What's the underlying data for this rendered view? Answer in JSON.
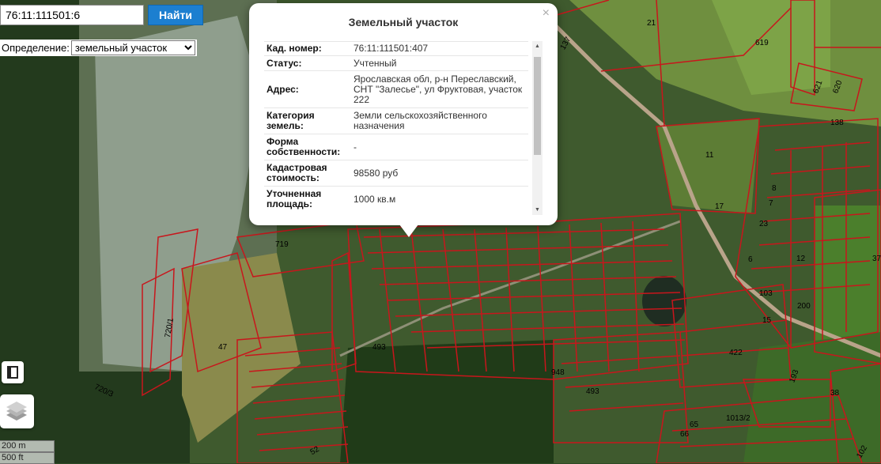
{
  "search": {
    "value": "76:11:111501:6",
    "button": "Найти"
  },
  "definition": {
    "label": "Определение:",
    "selected": "земельный участок"
  },
  "popup": {
    "title": "Земельный участок",
    "close": "×",
    "rows": [
      {
        "key": "Кад. номер:",
        "value": "76:11:111501:407"
      },
      {
        "key": "Статус:",
        "value": "Учтенный"
      },
      {
        "key": "Адрес:",
        "value": "Ярославская обл, р-н Переславский, СНТ \"Залесье\", ул Фруктовая, участок 222"
      },
      {
        "key": "Категория земель:",
        "value": "Земли сельскохозяйственного назначения"
      },
      {
        "key": "Форма собственности:",
        "value": "-"
      },
      {
        "key": "Кадастровая стоимость:",
        "value": "98580 руб"
      },
      {
        "key": "Уточненная площадь:",
        "value": "1000 кв.м"
      }
    ]
  },
  "scale": {
    "metric": "200 m",
    "imperial": "500 ft"
  },
  "parcel_labels": [
    "21",
    "619",
    "137",
    "621",
    "620",
    "138",
    "11",
    "8",
    "7",
    "17",
    "23",
    "12",
    "6",
    "37",
    "719",
    "103",
    "200",
    "15",
    "720/1",
    "47",
    "493",
    "422",
    "948",
    "493",
    "193",
    "38",
    "720/3",
    "65",
    "66",
    "1013/2",
    "52",
    "102"
  ],
  "colors": {
    "parcel_border": "#c8161c",
    "button": "#1c7fd0",
    "water": "#1f2d22"
  }
}
